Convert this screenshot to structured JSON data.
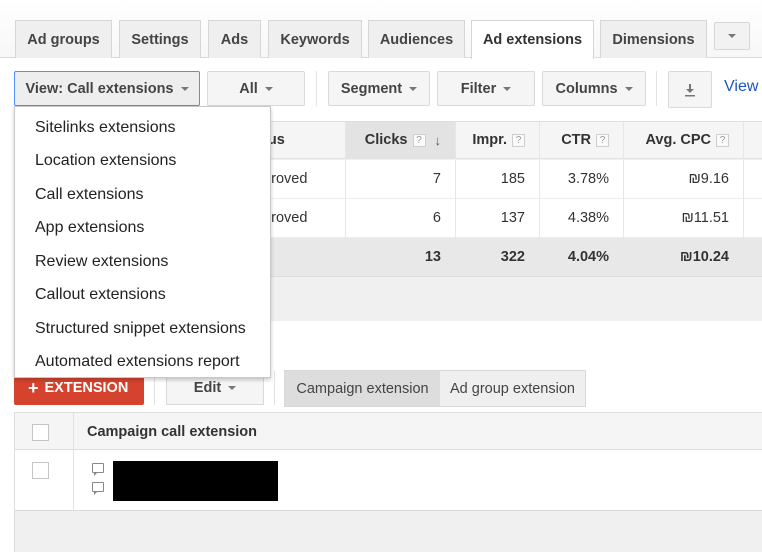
{
  "tabs": [
    {
      "label": "Ad groups",
      "active": false
    },
    {
      "label": "Settings",
      "active": false
    },
    {
      "label": "Ads",
      "active": false
    },
    {
      "label": "Keywords",
      "active": false
    },
    {
      "label": "Audiences",
      "active": false
    },
    {
      "label": "Ad extensions",
      "active": true
    },
    {
      "label": "Dimensions",
      "active": false
    }
  ],
  "tab_more_icon": "chevron-down-icon",
  "toolbar": {
    "view_label": "View: Call extensions",
    "all_label": "All",
    "segment_label": "Segment",
    "filter_label": "Filter",
    "columns_label": "Columns",
    "download_icon": "download-icon",
    "view_link": "View"
  },
  "view_menu": {
    "items": [
      "Sitelinks extensions",
      "Location extensions",
      "Call extensions",
      "App extensions",
      "Review extensions",
      "Callout extensions",
      "Structured snippet extensions",
      "Automated extensions report"
    ]
  },
  "stats_table": {
    "headers": {
      "status": "atus",
      "clicks": "Clicks",
      "impr": "Impr.",
      "ctr": "CTR",
      "avg_cpc": "Avg. CPC",
      "help": "?",
      "sort_arrow": "↓"
    },
    "rows": [
      {
        "status": "pproved",
        "clicks": "7",
        "impr": "185",
        "ctr": "3.78%",
        "avg_cpc": "₪9.16"
      },
      {
        "status": "pproved",
        "clicks": "6",
        "impr": "137",
        "ctr": "4.38%",
        "avg_cpc": "₪11.51"
      }
    ],
    "total": {
      "clicks": "13",
      "impr": "322",
      "ctr": "4.04%",
      "avg_cpc": "₪10.24"
    }
  },
  "actions": {
    "add_extension_label": "EXTENSION",
    "add_icon": "+",
    "edit_label": "Edit",
    "segments": [
      {
        "label": "Campaign extension",
        "selected": true
      },
      {
        "label": "Ad group extension",
        "selected": false
      }
    ]
  },
  "ext_table": {
    "header": "Campaign call extension",
    "rows": [
      {
        "content": "[redacted]"
      }
    ]
  },
  "colors": {
    "accent_red": "#d5432e",
    "link_blue": "#1a55c2",
    "focus_blue": "#4d90fe"
  }
}
